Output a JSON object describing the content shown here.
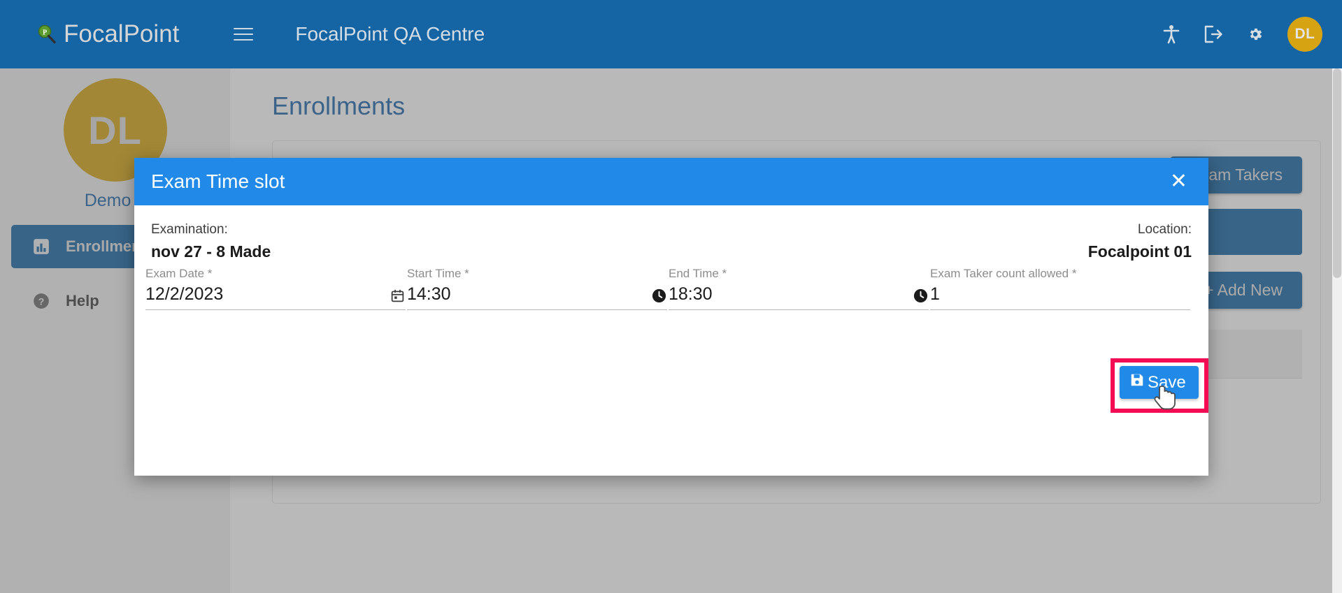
{
  "topbar": {
    "brand": "FocalPoint",
    "brand_logo_icon": "magnifier-logo-icon",
    "menu_icon": "hamburger-menu-icon",
    "centre_title": "FocalPoint QA Centre",
    "accessibility_icon": "accessibility-icon",
    "logout_icon": "logout-icon",
    "settings_icon": "gear-icon",
    "avatar_initials": "DL",
    "bg_color": "#1565a5"
  },
  "sidebar": {
    "avatar_initials": "DL",
    "avatar_color": "#d6a412",
    "username": "Demo L",
    "items": [
      {
        "label": "Enrollments",
        "icon": "chart-bar-icon",
        "active": true
      },
      {
        "label": "Help",
        "icon": "question-circle-icon",
        "active": false
      }
    ]
  },
  "main": {
    "page_title": "Enrollments",
    "exam_takers_label": "Exam Takers",
    "add_new_label": "+ Add New"
  },
  "modal": {
    "title": "Exam Time slot",
    "close_icon": "close-icon",
    "header_color": "#2189e8",
    "examination_label": "Examination:",
    "examination_value": "nov 27 - 8 Made",
    "location_label": "Location:",
    "location_value": "Focalpoint 01",
    "fields": [
      {
        "label": "Exam Date *",
        "value": "12/2/2023",
        "placeholder": "",
        "icon": "calendar-icon"
      },
      {
        "label": "Start Time *",
        "value": "14:30",
        "placeholder": "",
        "icon": "clock-icon"
      },
      {
        "label": "End Time *",
        "value": "18:30",
        "placeholder": "",
        "icon": "clock-icon"
      },
      {
        "label": "Exam Taker count allowed *",
        "value": "1",
        "placeholder": "",
        "icon": ""
      }
    ],
    "save_label": "Save",
    "save_icon": "floppy-save-icon",
    "save_color": "#2189e8",
    "highlight_color": "#f50a54"
  },
  "cursor": {
    "icon": "pointing-hand-cursor"
  }
}
